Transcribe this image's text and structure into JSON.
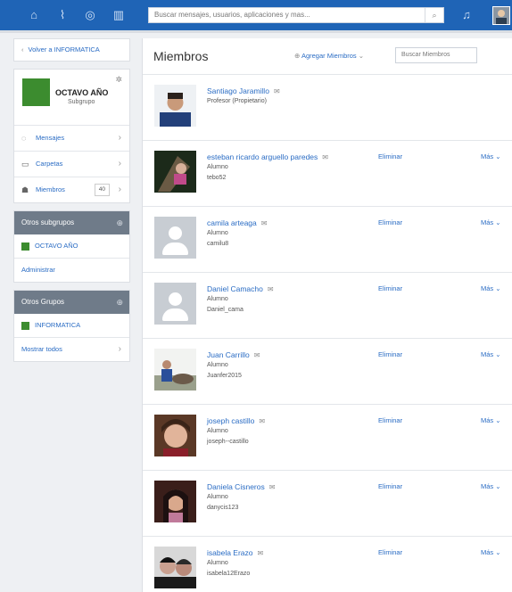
{
  "topbar": {
    "icons": [
      "home-icon",
      "activity-icon",
      "discover-icon",
      "book-icon",
      "bell-icon"
    ],
    "search_placeholder": "Buscar mensajes, usuarios, aplicaciones y mas..."
  },
  "sidebar": {
    "back_label": "Volver a INFORMATICA",
    "group": {
      "name": "OCTAVO AÑO",
      "type": "Subgrupo"
    },
    "nav": [
      {
        "label": "Mensajes",
        "icon": "chat-icon"
      },
      {
        "label": "Carpetas",
        "icon": "folder-icon"
      },
      {
        "label": "Miembros",
        "icon": "members-icon",
        "count": "40"
      }
    ],
    "subgroups": {
      "title": "Otros subgrupos",
      "items": [
        "OCTAVO AÑO"
      ],
      "manage_label": "Administrar"
    },
    "othergroups": {
      "title": "Otros Grupos",
      "items": [
        "INFORMATICA"
      ],
      "show_all_label": "Mostrar todos"
    }
  },
  "main": {
    "title": "Miembros",
    "add_label": "Agregar Miembros",
    "search_placeholder": "Buscar Miembros",
    "remove_label": "Eliminar",
    "more_label": "Más",
    "members": [
      {
        "name": "Santiago Jaramillo",
        "role": "Profesor (Propietario)",
        "username": ""
      },
      {
        "name": "esteban ricardo arguello paredes",
        "role": "Alumno",
        "username": "tebo52"
      },
      {
        "name": "camila arteaga",
        "role": "Alumno",
        "username": "camilu8"
      },
      {
        "name": "Daniel Camacho",
        "role": "Alumno",
        "username": "Daniel_cama"
      },
      {
        "name": "Juan Carrillo",
        "role": "Alumno",
        "username": "Juanfer2015"
      },
      {
        "name": "joseph castillo",
        "role": "Alumno",
        "username": "joseph--castillo"
      },
      {
        "name": "Daniela Cisneros",
        "role": "Alumno",
        "username": "danycis123"
      },
      {
        "name": "isabela Erazo",
        "role": "Alumno",
        "username": "isabela12Erazo"
      }
    ]
  },
  "colors": {
    "topbar": "#1f64b6",
    "link": "#2a6cc4",
    "group_green": "#3c8c2f",
    "section_gray": "#6f7b89"
  }
}
